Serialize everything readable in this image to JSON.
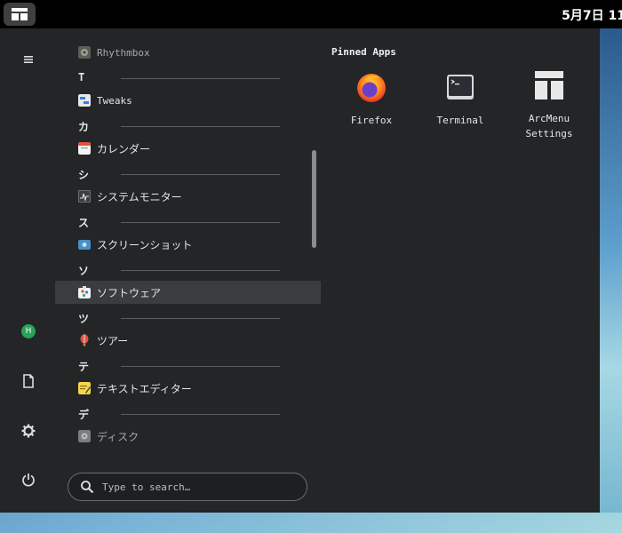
{
  "topbar": {
    "clock": "5月7日 11"
  },
  "sidebar": {
    "avatar_letter": "H"
  },
  "app_list": [
    {
      "kind": "app",
      "label": "Rhythmbox",
      "icon": "rhythmbox-icon",
      "dim": true,
      "mono": true
    },
    {
      "kind": "letter",
      "label": "T"
    },
    {
      "kind": "app",
      "label": "Tweaks",
      "icon": "tweaks-icon",
      "mono": true
    },
    {
      "kind": "letter",
      "label": "カ"
    },
    {
      "kind": "app",
      "label": "カレンダー",
      "icon": "calendar-icon"
    },
    {
      "kind": "letter",
      "label": "シ"
    },
    {
      "kind": "app",
      "label": "システムモニター",
      "icon": "system-monitor-icon"
    },
    {
      "kind": "letter",
      "label": "ス"
    },
    {
      "kind": "app",
      "label": "スクリーンショット",
      "icon": "screenshot-icon"
    },
    {
      "kind": "letter",
      "label": "ソ"
    },
    {
      "kind": "app",
      "label": "ソフトウェア",
      "icon": "software-icon",
      "hover": true
    },
    {
      "kind": "letter",
      "label": "ツ"
    },
    {
      "kind": "app",
      "label": "ツアー",
      "icon": "tour-icon"
    },
    {
      "kind": "letter",
      "label": "テ"
    },
    {
      "kind": "app",
      "label": "テキストエディター",
      "icon": "text-editor-icon"
    },
    {
      "kind": "letter",
      "label": "デ"
    },
    {
      "kind": "app",
      "label": "ディスク",
      "icon": "disks-icon",
      "dim": true
    }
  ],
  "search": {
    "placeholder": "Type to search…"
  },
  "pinned": {
    "title": "Pinned Apps",
    "apps": [
      {
        "label": "Firefox",
        "icon": "firefox-icon"
      },
      {
        "label": "Terminal",
        "icon": "terminal-icon"
      },
      {
        "label": "ArcMenu Settings",
        "icon": "arcmenu-settings-icon"
      }
    ]
  }
}
